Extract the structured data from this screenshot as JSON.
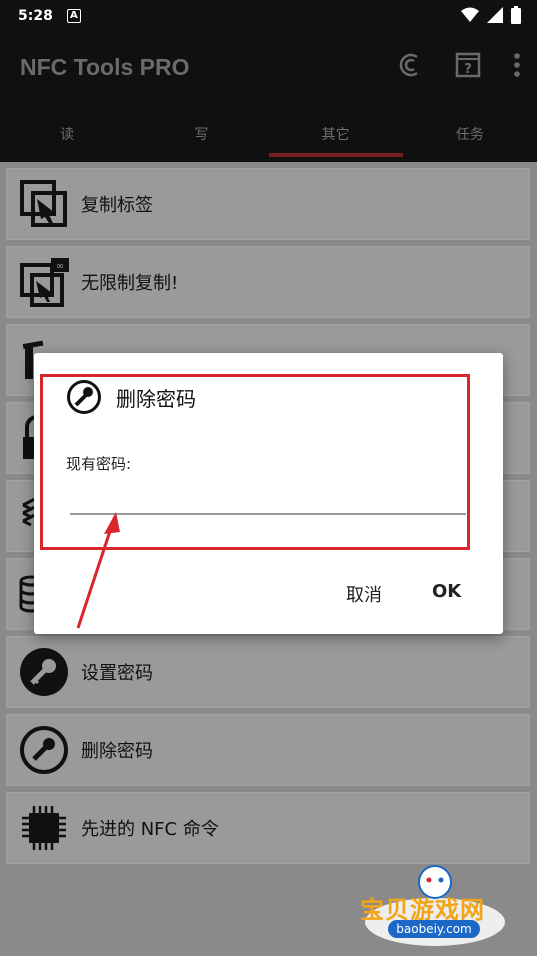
{
  "status_bar": {
    "time": "5:28",
    "badge": "A"
  },
  "app_bar": {
    "title": "NFC Tools PRO"
  },
  "tabs": [
    {
      "label": "读"
    },
    {
      "label": "写"
    },
    {
      "label": "其它"
    },
    {
      "label": "任务"
    }
  ],
  "list": [
    {
      "label": "复制标签",
      "icon": "copy-tag-icon"
    },
    {
      "label": "无限制复制!",
      "icon": "unlimited-copy-icon"
    },
    {
      "label": "",
      "icon": "hidden-item-icon"
    },
    {
      "label": "",
      "icon": "lock-icon"
    },
    {
      "label": "",
      "icon": "layers-icon"
    },
    {
      "label": "",
      "icon": "database-icon"
    },
    {
      "label": "设置密码",
      "icon": "key-icon"
    },
    {
      "label": "删除密码",
      "icon": "key-remove-icon"
    },
    {
      "label": "先进的 NFC 命令",
      "icon": "chip-icon"
    }
  ],
  "dialog": {
    "title": "删除密码",
    "field_label": "现有密码:",
    "field_value": "",
    "cancel_label": "取消",
    "ok_label": "OK"
  },
  "watermark": {
    "text": "宝贝游戏网",
    "url": "baobeiy.com"
  },
  "colors": {
    "accent": "#d9262b",
    "tab_indicator": "#7a1e1e",
    "app_bar": "#101010"
  }
}
